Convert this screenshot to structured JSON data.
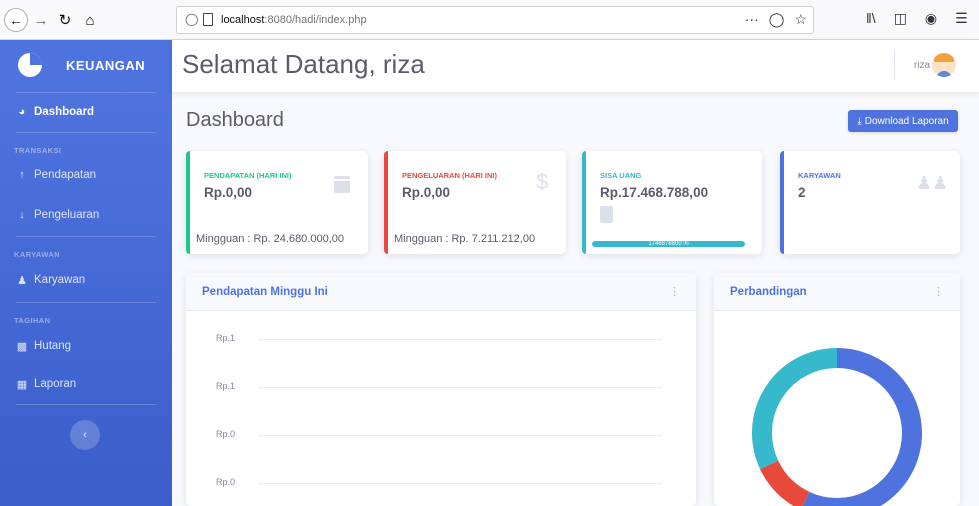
{
  "browser": {
    "back_icon": "back-arrow-icon",
    "url_host": "localhost",
    "url_rest": ":8080/hadi/index.php",
    "more_label": "···"
  },
  "sidebar": {
    "brand": "KEUANGAN",
    "items": {
      "dashboard": "Dashboard",
      "heading_transaksi": "TRANSAKSI",
      "pendapatan": "Pendapatan",
      "pengeluaran": "Pengeluaran",
      "heading_karyawan": "KARYAWAN",
      "karyawan": "Karyawan",
      "heading_tagihan": "TAGIHAN",
      "hutang": "Hutang",
      "laporan": "Laporan"
    }
  },
  "topbar": {
    "welcome": "Selamat Datang, riza",
    "user": "riza"
  },
  "page": {
    "title": "Dashboard",
    "download_label": "Download Laporan"
  },
  "cards": {
    "pendapatan": {
      "label": "PENDAPATAN (HARI INI)",
      "value": "Rp.0,00",
      "sub": "Mingguan : Rp. 24.680.000,00"
    },
    "pengeluaran": {
      "label": "PENGELUARAN (HARI INI)",
      "value": "Rp.0,00",
      "sub": "Mingguan : Rp. 7.211.212,00"
    },
    "sisa": {
      "label": "SISA UANG",
      "value": "Rp.17.468.788,00",
      "progress_text": "1746878800 %",
      "progress_fill": 1.0
    },
    "karyawan": {
      "label": "KARYAWAN",
      "value": "2"
    }
  },
  "colors": {
    "primary": "#4e73df",
    "success": "#1cc88a",
    "danger": "#e74a3b",
    "info": "#36b9cc"
  },
  "chart_data": [
    {
      "type": "line",
      "title": "Pendapatan Minggu Ini",
      "y_ticks": [
        "Rp.1",
        "Rp.1",
        "Rp.0",
        "Rp.0"
      ],
      "series": []
    },
    {
      "type": "pie",
      "title": "Perbandingan",
      "slices": [
        {
          "value": 57,
          "color": "#4e73df"
        },
        {
          "value": 11,
          "color": "#e74a3b"
        },
        {
          "value": 32,
          "color": "#36b9cc"
        }
      ]
    }
  ]
}
